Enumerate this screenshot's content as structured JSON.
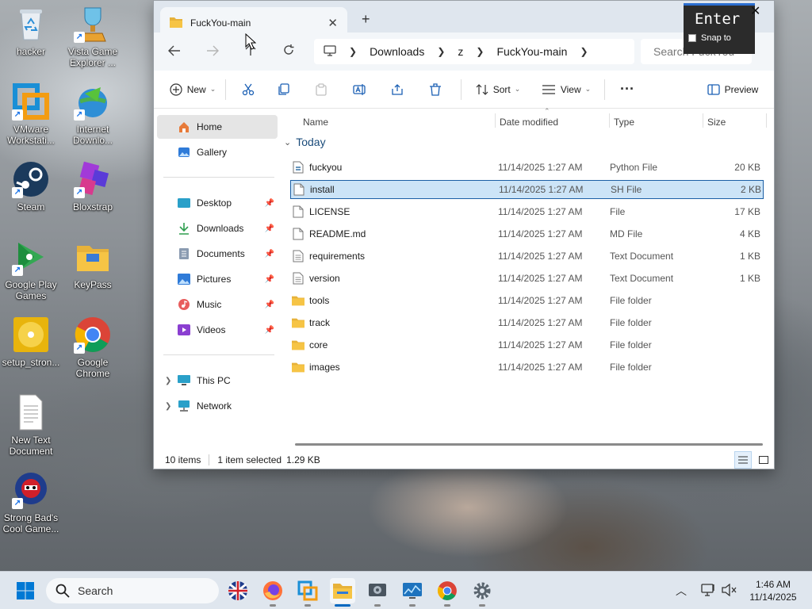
{
  "desktop": {
    "icons": [
      {
        "label": "hacker",
        "icon": "recycle-bin-icon"
      },
      {
        "label": "Vista Game Explorer ...",
        "icon": "trophy-icon"
      },
      {
        "label": "VMware Workstati...",
        "icon": "vmware-icon"
      },
      {
        "label": "Internet Downlo...",
        "icon": "internet-download-manager-icon"
      },
      {
        "label": "Steam",
        "icon": "steam-icon"
      },
      {
        "label": "Bloxstrap",
        "icon": "bloxstrap-icon"
      },
      {
        "label": "Google Play Games",
        "icon": "google-play-games-icon"
      },
      {
        "label": "KeyPass",
        "icon": "folder-icon"
      },
      {
        "label": "setup_stron...",
        "icon": "disc-icon"
      },
      {
        "label": "Google Chrome",
        "icon": "chrome-icon"
      },
      {
        "label": "New Text Document",
        "icon": "text-file-icon"
      },
      {
        "label": "Strong Bad's Cool Game...",
        "icon": "strong-bad-icon"
      }
    ]
  },
  "window": {
    "tab_title": "FuckYou-main",
    "breadcrumb": [
      "Downloads",
      "z",
      "FuckYou-main"
    ],
    "search_placeholder": "Search FuckYou",
    "toolbar": {
      "new_label": "New",
      "sort_label": "Sort",
      "view_label": "View",
      "more_label": "···",
      "preview_label": "Preview"
    },
    "nav": {
      "home": "Home",
      "gallery": "Gallery",
      "desktop": "Desktop",
      "downloads": "Downloads",
      "documents": "Documents",
      "pictures": "Pictures",
      "music": "Music",
      "videos": "Videos",
      "this_pc": "This PC",
      "network": "Network"
    },
    "columns": {
      "name": "Name",
      "date": "Date modified",
      "type": "Type",
      "size": "Size"
    },
    "group_label": "Today",
    "files": [
      {
        "name": "fuckyou",
        "date": "11/14/2025 1:27 AM",
        "type": "Python File",
        "size": "20 KB",
        "icon": "python-file-icon"
      },
      {
        "name": "install",
        "date": "11/14/2025 1:27 AM",
        "type": "SH File",
        "size": "2 KB",
        "icon": "file-icon"
      },
      {
        "name": "LICENSE",
        "date": "11/14/2025 1:27 AM",
        "type": "File",
        "size": "17 KB",
        "icon": "file-icon"
      },
      {
        "name": "README.md",
        "date": "11/14/2025 1:27 AM",
        "type": "MD File",
        "size": "4 KB",
        "icon": "file-icon"
      },
      {
        "name": "requirements",
        "date": "11/14/2025 1:27 AM",
        "type": "Text Document",
        "size": "1 KB",
        "icon": "text-file-icon"
      },
      {
        "name": "version",
        "date": "11/14/2025 1:27 AM",
        "type": "Text Document",
        "size": "1 KB",
        "icon": "text-file-icon"
      },
      {
        "name": "tools",
        "date": "11/14/2025 1:27 AM",
        "type": "File folder",
        "size": "",
        "icon": "folder-icon"
      },
      {
        "name": "track",
        "date": "11/14/2025 1:27 AM",
        "type": "File folder",
        "size": "",
        "icon": "folder-icon"
      },
      {
        "name": "core",
        "date": "11/14/2025 1:27 AM",
        "type": "File folder",
        "size": "",
        "icon": "folder-icon"
      },
      {
        "name": "images",
        "date": "11/14/2025 1:27 AM",
        "type": "File folder",
        "size": "",
        "icon": "folder-icon"
      }
    ],
    "status": {
      "count": "10 items",
      "selected": "1 item selected",
      "sel_size": "1.29 KB"
    }
  },
  "key_overlay": {
    "key": "Enter",
    "snap_label": "Snap to"
  },
  "taskbar": {
    "search_placeholder": "Search",
    "time": "1:46 AM",
    "date": "11/14/2025"
  },
  "colors": {
    "accent": "#0067c0",
    "selection": "#cce4f7",
    "folder": "#f6c445"
  }
}
